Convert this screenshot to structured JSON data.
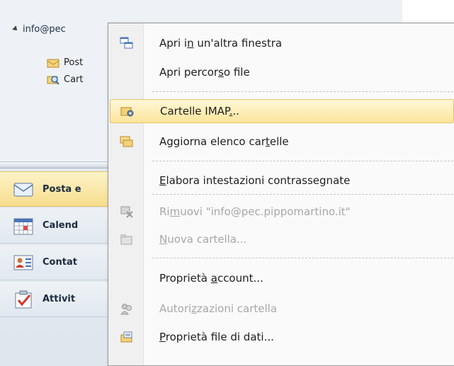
{
  "account": {
    "name": "info@pec"
  },
  "folders": [
    {
      "label": "Post"
    },
    {
      "label": "Cart"
    }
  ],
  "nav": [
    {
      "label": "Posta e",
      "icon": "mail-envelope-icon",
      "active": true
    },
    {
      "label": "Calend",
      "icon": "calendar-icon",
      "active": false
    },
    {
      "label": "Contat",
      "icon": "contact-card-icon",
      "active": false
    },
    {
      "label": "Attivit",
      "icon": "task-check-icon",
      "active": false
    }
  ],
  "menu": {
    "items": [
      {
        "pre": "Apri i",
        "key": "n",
        "post": " un'altra finestra",
        "icon": "open-window-icon",
        "disabled": false,
        "highlighted": false
      },
      {
        "pre": "Apri percor",
        "key": "s",
        "post": "o file",
        "icon": "",
        "disabled": false,
        "highlighted": false
      },
      {
        "pre": "Cartelle IMAP",
        "key": ".",
        "post": "..",
        "icon": "imap-folder-gear-icon",
        "disabled": false,
        "highlighted": true
      },
      {
        "pre": "Aggiorna elenco car",
        "key": "t",
        "post": "elle",
        "icon": "folders-refresh-icon",
        "disabled": false,
        "highlighted": false
      },
      {
        "pre": "",
        "key": "E",
        "post": "labora intestazioni contrassegnate",
        "icon": "",
        "disabled": false,
        "highlighted": false
      },
      {
        "pre": "Ri",
        "key": "m",
        "post": "uovi \"info@pec.pippomartino.it\"",
        "icon": "remove-account-icon",
        "disabled": true,
        "highlighted": false
      },
      {
        "pre": "",
        "key": "N",
        "post": "uova cartella...",
        "icon": "new-folder-icon",
        "disabled": true,
        "highlighted": false
      },
      {
        "pre": "Proprietà ",
        "key": "a",
        "post": "ccount...",
        "icon": "",
        "disabled": false,
        "highlighted": false
      },
      {
        "pre": "Autori",
        "key": "z",
        "post": "zazioni cartella",
        "icon": "folder-permissions-icon",
        "disabled": true,
        "highlighted": false
      },
      {
        "pre": "",
        "key": "P",
        "post": "roprietà file di dati...",
        "icon": "data-file-properties-icon",
        "disabled": false,
        "highlighted": false
      }
    ]
  }
}
